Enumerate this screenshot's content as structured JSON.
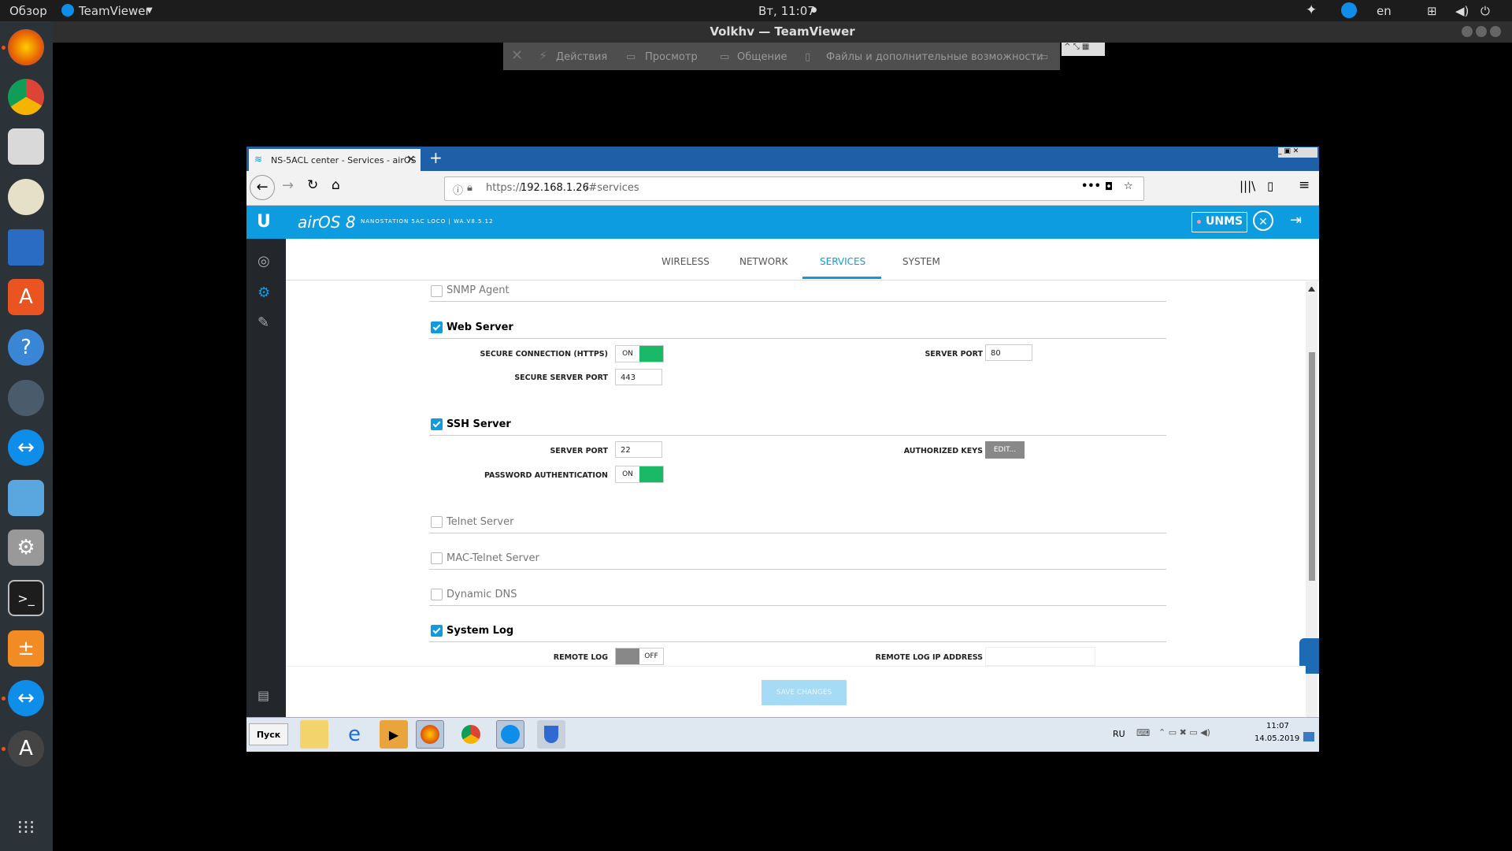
{
  "topbar": {
    "overview": "Обзор",
    "app_name": "TeamViewer",
    "clock": "Вт, 11:07",
    "language": "en"
  },
  "teamviewer": {
    "window_title": "Volkhv — TeamViewer",
    "toolbar": {
      "actions": "Действия",
      "view": "Просмотр",
      "communication": "Общение",
      "files": "Файлы и дополнительные возможности"
    }
  },
  "browser": {
    "tab_title": "NS-5ACL center - Services - airOS",
    "url_prefix": "https://",
    "url_host": "192.168.1.26",
    "url_path": "/#services"
  },
  "airos": {
    "logo": "airOS 8",
    "device_info": "NANOSTATION 5AC LOCO | WA.V8.5.12",
    "unms_label": "UNMS",
    "tabs": [
      "WIRELESS",
      "NETWORK",
      "SERVICES",
      "SYSTEM"
    ],
    "active_tab": "SERVICES",
    "sections": {
      "snmp": {
        "title": "SNMP Agent",
        "checked": false
      },
      "web": {
        "title": "Web Server",
        "checked": true,
        "secure_connection_label": "SECURE CONNECTION (HTTPS)",
        "secure_connection_state": "ON",
        "server_port_label": "SERVER PORT",
        "server_port": "80",
        "secure_port_label": "SECURE SERVER PORT",
        "secure_port": "443"
      },
      "ssh": {
        "title": "SSH Server",
        "checked": true,
        "server_port_label": "SERVER PORT",
        "server_port": "22",
        "authorized_keys_label": "AUTHORIZED KEYS",
        "edit_button": "EDIT...",
        "password_auth_label": "PASSWORD AUTHENTICATION",
        "password_auth_state": "ON"
      },
      "telnet": {
        "title": "Telnet Server",
        "checked": false
      },
      "mactelnet": {
        "title": "MAC-Telnet Server",
        "checked": false
      },
      "ddns": {
        "title": "Dynamic DNS",
        "checked": false
      },
      "syslog": {
        "title": "System Log",
        "checked": true,
        "remote_log_label": "REMOTE LOG",
        "remote_log_state": "OFF",
        "remote_ip_label": "REMOTE LOG IP ADDRESS"
      }
    },
    "save_button": "SAVE CHANGES"
  },
  "windows_taskbar": {
    "start": "Пуск",
    "lang": "RU",
    "time": "11:07",
    "date": "14.05.2019"
  },
  "colors": {
    "airos_blue": "#0d9ce0",
    "toggle_green": "#19b968",
    "ubuntu_orange": "#e95420"
  }
}
